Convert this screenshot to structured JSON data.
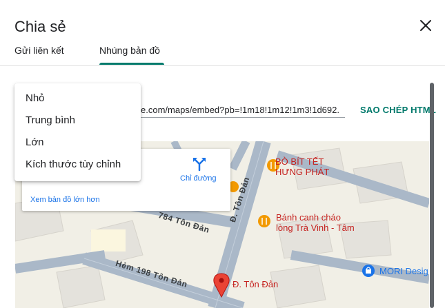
{
  "dialog": {
    "title": "Chia sẻ",
    "close_icon": "close-icon"
  },
  "tabs": [
    {
      "label": "Gửi liên kết",
      "active": false
    },
    {
      "label": "Nhúng bản đồ",
      "active": true
    }
  ],
  "embed": {
    "code_value": "e.com/maps/embed?pb=!1m18!1m12!1m3!1d692.",
    "copy_label": "SAO CHÉP HTML"
  },
  "size_menu": {
    "options": [
      "Nhỏ",
      "Trung bình",
      "Lớn",
      "Kích thước tùy chỉnh"
    ]
  },
  "map": {
    "card": {
      "larger_map_link": "Xem bản đồ lớn hơn",
      "directions_label": "Chỉ đường",
      "directions_icon": "directions-icon"
    },
    "places": [
      {
        "line1": "BÒ BÍT TẾT",
        "line2": "HƯNG PHÁT",
        "icon": "restaurant-icon"
      },
      {
        "line1": "Bánh canh cháo",
        "line2": "lòng Trà Vinh - Tâm",
        "icon": "restaurant-icon"
      },
      {
        "line1": "MORI Desig",
        "icon": "shopping-icon"
      },
      {
        "line1": "Đ. Tôn Đản",
        "icon": "map-pin-icon"
      }
    ],
    "streets": [
      "Đ. Tôn Đản",
      "784 Tôn Đản",
      "Hẻm 198 Tôn Đản"
    ],
    "colors": {
      "land": "#f1efe6",
      "road": "#aab8c8",
      "building": "#e4e2dc",
      "pin": "#ea4335",
      "poi": "#f29900",
      "poi_text": "#c5221f",
      "accent": "#00796b",
      "link": "#1a73e8"
    }
  }
}
